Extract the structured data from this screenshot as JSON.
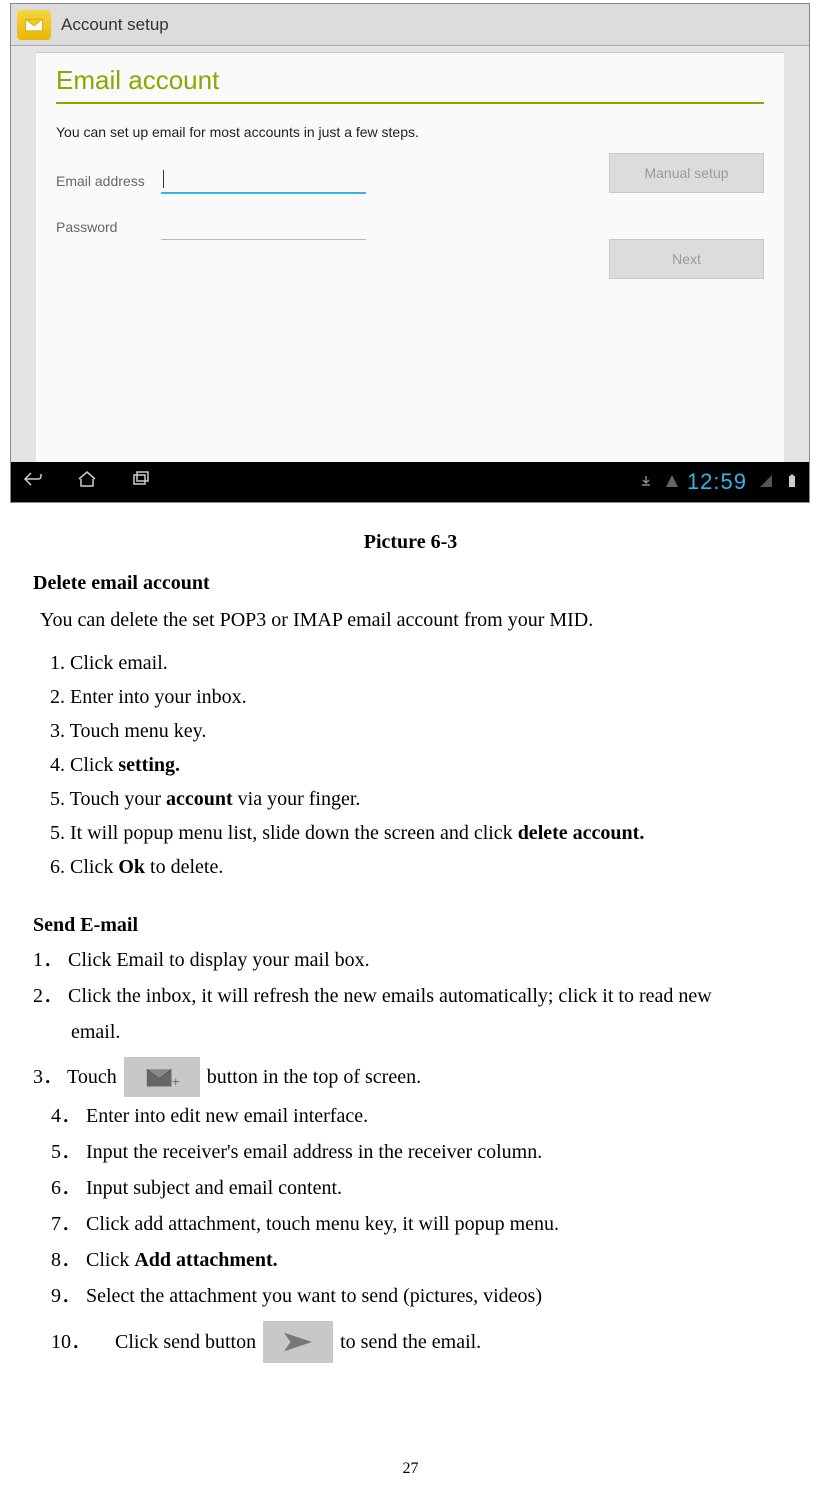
{
  "screenshot": {
    "header_title": "Account setup",
    "body_title": "Email account",
    "hint": "You can set up email for most accounts in just a few steps.",
    "field_email_label": "Email address",
    "field_password_label": "Password",
    "btn_manual": "Manual setup",
    "btn_next": "Next",
    "clock": "12:59"
  },
  "doc": {
    "caption": "Picture 6-3",
    "delete_title": "Delete email account",
    "delete_intro": "You can delete the set POP3 or IMAP email account from your MID.",
    "delete_steps": [
      {
        "n": "1.",
        "pre": "Click email."
      },
      {
        "n": "2.",
        "pre": "Enter into your inbox."
      },
      {
        "n": "3.",
        "pre": "Touch menu key."
      },
      {
        "n": "4.",
        "pre": "Click ",
        "bold": "setting."
      },
      {
        "n": "5.",
        "pre": "Touch your ",
        "bold": "account",
        "post": " via your finger."
      },
      {
        "n": "5.",
        "pre": "It will popup menu list, slide down the screen and click ",
        "bold": "delete account."
      },
      {
        "n": "6.",
        "pre": "Click ",
        "bold": "Ok",
        "post": " to delete."
      }
    ],
    "send_title": "Send E-mail",
    "send_step1_n": "1．",
    "send_step1": "Click Email to display your mail box.",
    "send_step2_n": "2．",
    "send_step2a": "Click  the  inbox,  it  will  refresh  the  new  emails  automatically;  click  it  to  read  new",
    "send_step2b": "email.",
    "send_step3_n": "3．",
    "send_step3_pre": "Touch",
    "send_step3_post": "  button in the top of screen.",
    "send_step4_n": "4．",
    "send_step4": "Enter into edit new email interface.",
    "send_step5_n": "5．",
    "send_step5": "Input the receiver's email address in the receiver column.",
    "send_step6_n": "6．",
    "send_step6": "Input subject and email content.",
    "send_step7_n": "7．",
    "send_step7": "Click add attachment, touch menu key, it will popup menu.",
    "send_step8_n": "8．",
    "send_step8_pre": " Click ",
    "send_step8_bold": "Add attachment.",
    "send_step9_n": "9．",
    "send_step9": " Select the attachment you want to send (pictures, videos)",
    "send_step10_n": "10．",
    "send_step10_pre": "Click send button ",
    "send_step10_post": " to send the email.",
    "page_number": "27"
  }
}
